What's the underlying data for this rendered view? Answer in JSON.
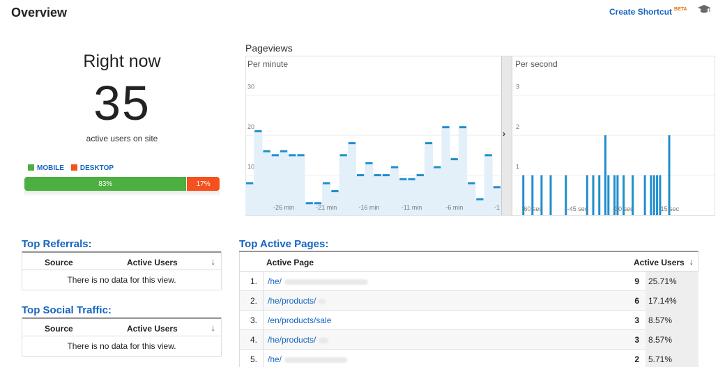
{
  "header": {
    "title": "Overview",
    "create_shortcut": "Create Shortcut",
    "beta": "BETA",
    "icon": "graduation-cap-icon"
  },
  "right_now": {
    "title": "Right now",
    "count": "35",
    "subtitle": "active users on site",
    "legend_mobile": "MOBILE",
    "legend_desktop": "DESKTOP",
    "mobile_pct": "83%",
    "desktop_pct": "17%",
    "mobile_fraction": 0.83,
    "colors": {
      "mobile": "#4cb040",
      "desktop": "#f4511e"
    }
  },
  "pageviews": {
    "title": "Pageviews",
    "per_minute_label": "Per minute",
    "per_second_label": "Per second",
    "divider_arrow": "›"
  },
  "chart_data": [
    {
      "type": "area",
      "title": "Per minute",
      "ylim": [
        0,
        35
      ],
      "yticks": [
        "10",
        "20",
        "30"
      ],
      "ytick_values": [
        10,
        20,
        30
      ],
      "xticks": [
        "-26 min",
        "-21 min",
        "-16 min",
        "-11 min",
        "-6 min",
        "-1"
      ],
      "xtick_positions": [
        -26,
        -21,
        -16,
        -11,
        -6,
        -1
      ],
      "x": [
        -30,
        -29,
        -28,
        -27,
        -26,
        -25,
        -24,
        -23,
        -22,
        -21,
        -20,
        -19,
        -18,
        -17,
        -16,
        -15,
        -14,
        -13,
        -12,
        -11,
        -10,
        -9,
        -8,
        -7,
        -6,
        -5,
        -4,
        -3,
        -2,
        -1
      ],
      "values": [
        8,
        21,
        16,
        15,
        16,
        15,
        15,
        3,
        3,
        8,
        6,
        15,
        18,
        10,
        13,
        10,
        10,
        12,
        9,
        9,
        10,
        18,
        12,
        22,
        14,
        22,
        8,
        4,
        15,
        7
      ],
      "color": "#1f8ecd",
      "fill": "#e3f0fa"
    },
    {
      "type": "bar",
      "title": "Per second",
      "ylim": [
        0,
        3.5
      ],
      "yticks": [
        "1",
        "2",
        "3"
      ],
      "ytick_values": [
        1,
        2,
        3
      ],
      "xticks": [
        "-60 sec",
        "-45 sec",
        "-30 sec",
        "-15 sec"
      ],
      "xtick_positions": [
        -60,
        -45,
        -30,
        -15
      ],
      "x": [
        -59,
        -56,
        -53,
        -50,
        -45,
        -38,
        -36,
        -34,
        -32,
        -31,
        -29,
        -28,
        -26,
        -23,
        -19,
        -17,
        -16,
        -15,
        -14,
        -11
      ],
      "values": [
        1,
        1,
        1,
        1,
        1,
        1,
        1,
        1,
        2,
        1,
        1,
        1,
        1,
        1,
        1,
        1,
        1,
        1,
        1,
        2
      ],
      "color": "#1f8ecd"
    }
  ],
  "top_referrals": {
    "title": "Top Referrals:",
    "col_source": "Source",
    "col_active": "Active Users",
    "empty": "There is no data for this view."
  },
  "top_social": {
    "title": "Top Social Traffic:",
    "col_source": "Source",
    "col_active": "Active Users",
    "empty": "There is no data for this view."
  },
  "top_pages": {
    "title": "Top Active Pages:",
    "col_page": "Active Page",
    "col_active": "Active Users",
    "rows": [
      {
        "num": "1.",
        "page": "/he/",
        "count": "9",
        "pct": "25.71%",
        "blur_w": 120
      },
      {
        "num": "2.",
        "page": "/he/products/",
        "count": "6",
        "pct": "17.14%",
        "blur_w": 10
      },
      {
        "num": "3.",
        "page": "/en/products/sale",
        "count": "3",
        "pct": "8.57%",
        "blur_w": 0
      },
      {
        "num": "4.",
        "page": "/he/products/",
        "count": "3",
        "pct": "8.57%",
        "blur_w": 14
      },
      {
        "num": "5.",
        "page": "/he/",
        "count": "2",
        "pct": "5.71%",
        "blur_w": 90
      }
    ]
  }
}
